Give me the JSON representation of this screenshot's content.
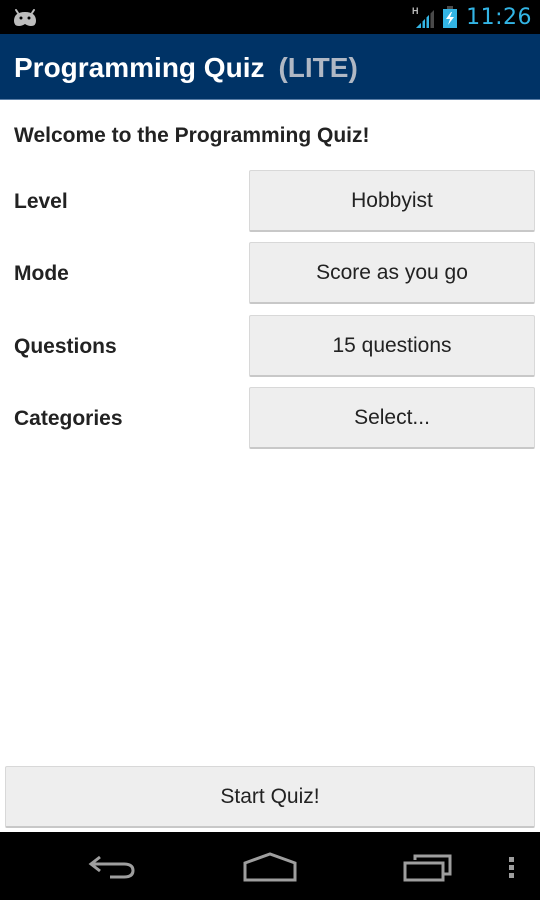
{
  "status_bar": {
    "notification_icon": "android-icon",
    "network_type": "H",
    "signal_icon": "signal-icon",
    "battery_icon": "battery-charging-icon",
    "time": "11:26",
    "accent_color": "#33b5e5"
  },
  "action_bar": {
    "title": "Programming Quiz",
    "subtitle": "(LITE)",
    "background_color": "#003366"
  },
  "main": {
    "welcome": "Welcome to the Programming Quiz!",
    "options": [
      {
        "label": "Level",
        "value": "Hobbyist"
      },
      {
        "label": "Mode",
        "value": "Score as you go"
      },
      {
        "label": "Questions",
        "value": "15 questions"
      },
      {
        "label": "Categories",
        "value": "Select..."
      }
    ],
    "start_button": "Start Quiz!"
  },
  "nav_bar": {
    "back": "back-icon",
    "home": "home-icon",
    "recents": "recent-apps-icon",
    "menu": "overflow-menu-icon"
  }
}
